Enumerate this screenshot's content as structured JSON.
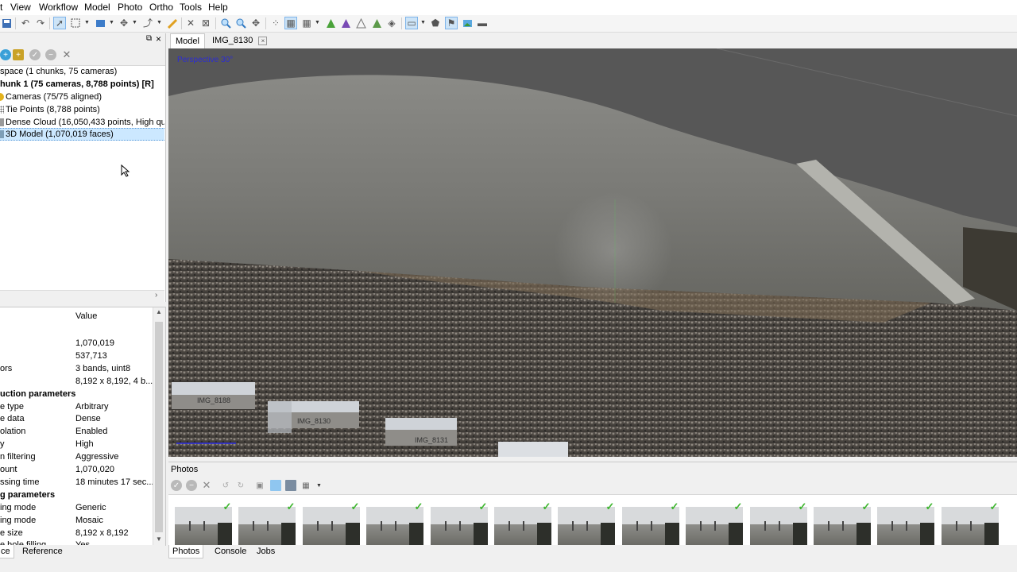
{
  "menu": [
    "t",
    "View",
    "Workflow",
    "Model",
    "Photo",
    "Ortho",
    "Tools",
    "Help"
  ],
  "workspace": {
    "tree": [
      {
        "label": "space (1 chunks, 75 cameras)",
        "bold": false
      },
      {
        "label": "hunk 1 (75 cameras, 8,788 points) [R]",
        "bold": true
      },
      {
        "label": "Cameras (75/75 aligned)",
        "bold": false,
        "icon": "camera-icon"
      },
      {
        "label": "Tie Points (8,788 points)",
        "bold": false,
        "icon": "points-icon"
      },
      {
        "label": "Dense Cloud (16,050,433 points, High qua",
        "bold": false,
        "icon": "cloud-icon"
      },
      {
        "label": "3D Model (1,070,019 faces)",
        "bold": false,
        "icon": "model-icon",
        "selected": true
      }
    ]
  },
  "properties": {
    "value_header": "Value",
    "rows": [
      {
        "key": "",
        "value": "1,070,019"
      },
      {
        "key": "",
        "value": "537,713"
      },
      {
        "key": "ors",
        "value": "3 bands, uint8"
      },
      {
        "key": "",
        "value": "8,192 x 8,192, 4 b..."
      },
      {
        "key": "uction parameters",
        "value": "",
        "group": true
      },
      {
        "key": "e type",
        "value": "Arbitrary"
      },
      {
        "key": "e data",
        "value": "Dense"
      },
      {
        "key": "olation",
        "value": "Enabled"
      },
      {
        "key": "y",
        "value": "High"
      },
      {
        "key": "n filtering",
        "value": "Aggressive"
      },
      {
        "key": "ount",
        "value": "1,070,020"
      },
      {
        "key": "ssing time",
        "value": "18 minutes 17 sec..."
      },
      {
        "key": "g parameters",
        "value": "",
        "group": true
      },
      {
        "key": "ing mode",
        "value": "Generic"
      },
      {
        "key": "ing mode",
        "value": "Mosaic"
      },
      {
        "key": "e size",
        "value": "8,192 x 8,192"
      },
      {
        "key": "e hole filling",
        "value": "Yes"
      }
    ]
  },
  "left_tabs": [
    "ce",
    "Reference"
  ],
  "model_tabs": [
    "Model",
    "IMG_8130"
  ],
  "viewport": {
    "projection_label": "Perspective 30°",
    "camera_labels": [
      "IMG_8188",
      "IMG_8130",
      "IMG_8131"
    ]
  },
  "photos": {
    "title": "Photos",
    "thumbnail_count": 13
  },
  "right_tabs": [
    "Photos",
    "Console",
    "Jobs"
  ],
  "colors": {
    "selection": "#cce8ff",
    "check": "#3db52e",
    "viewport_bg": "#575757"
  }
}
